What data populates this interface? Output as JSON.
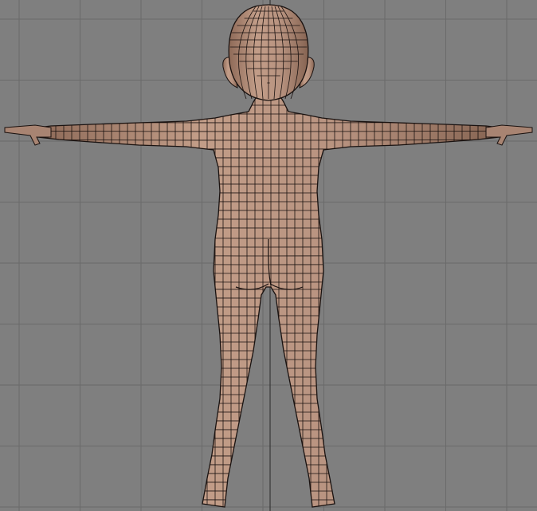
{
  "viewport": {
    "view": "back-orthographic",
    "background_color": "#7f7f7f",
    "grid_color": "#6a6a6a",
    "axis_color": "#2a2a2a"
  },
  "model": {
    "skin_color": "#b8927e",
    "wire_color": "#1a1210",
    "pose": "t-pose"
  }
}
